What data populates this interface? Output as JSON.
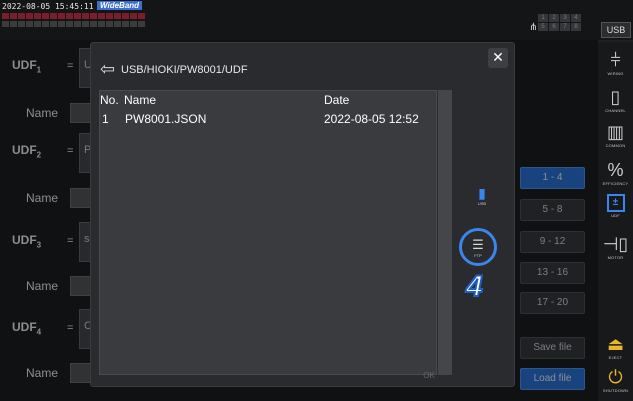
{
  "status": {
    "datetime": "2022-08-05 15:45:11",
    "bandwidth_badge": "WideBand",
    "wiring_numbers": [
      "1",
      "2",
      "3",
      "4",
      "5",
      "6",
      "7",
      "8"
    ],
    "usb_tab": "USB"
  },
  "udf_rows": [
    {
      "label": "UDF",
      "sub": "1",
      "expr": "U",
      "name_label": "Name"
    },
    {
      "label": "UDF",
      "sub": "2",
      "expr": "P",
      "name_label": "Name"
    },
    {
      "label": "UDF",
      "sub": "3",
      "expr": "s",
      "name_label": "Name"
    },
    {
      "label": "UDF",
      "sub": "4",
      "expr": "C",
      "name_label": "Name"
    }
  ],
  "udf_eq": "=",
  "range_buttons": [
    "1 - 4",
    "5 - 8",
    "9 - 12",
    "13 - 16",
    "17 - 20"
  ],
  "file_buttons": {
    "save": "Save file",
    "load": "Load file"
  },
  "sidebar": [
    {
      "icon": "wiring-icon",
      "label": "WIRING"
    },
    {
      "icon": "channel-icon",
      "label": "CHANNEL"
    },
    {
      "icon": "common-icon",
      "label": "COMMON"
    },
    {
      "icon": "efficiency-icon",
      "label": "EFFICIENCY"
    },
    {
      "icon": "udf-icon",
      "label": "UDF"
    },
    {
      "icon": "motor-icon",
      "label": "MOTOR"
    },
    {
      "icon": "eject-icon",
      "label": "EJECT"
    },
    {
      "icon": "shutdown-icon",
      "label": "SHUTDOWN"
    }
  ],
  "dialog": {
    "path": "USB/HIOKI/PW8001/UDF",
    "close": "✕",
    "headers": {
      "no": "No.",
      "name": "Name",
      "date": "Date"
    },
    "files": [
      {
        "no": "1",
        "name": "PW8001.JSON",
        "date": "2022-08-05 12:52"
      }
    ],
    "ok_label": "OK",
    "storage_usb_label": "USB",
    "storage_ftp_label": "FTP",
    "step_number": "4"
  },
  "colors": {
    "accent": "#2f7be8",
    "highlight_ring": "#3a85ee",
    "eject": "#e8b82a"
  }
}
